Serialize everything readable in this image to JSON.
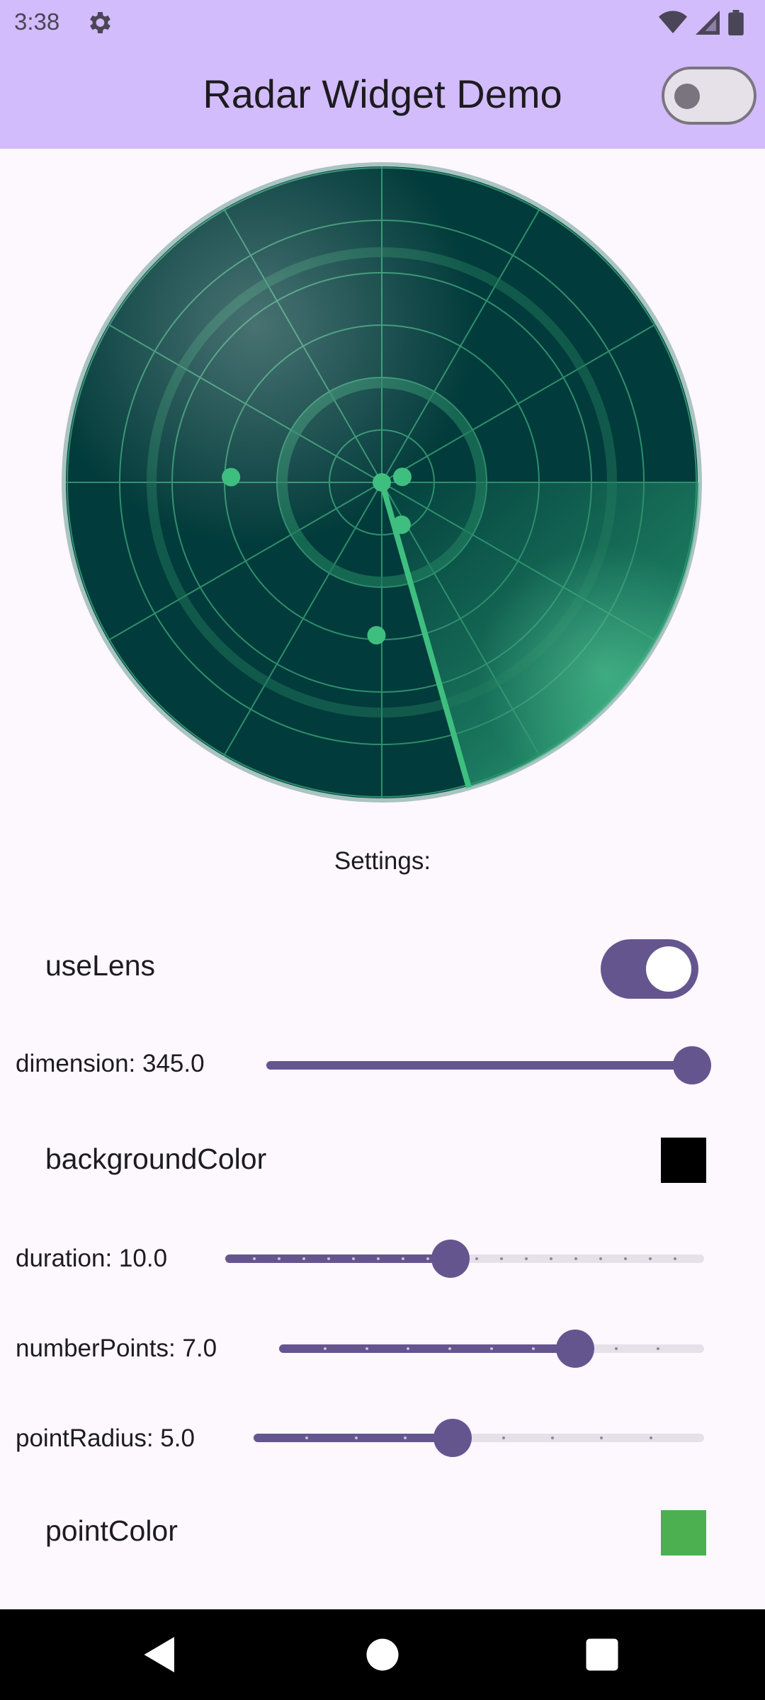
{
  "status_bar": {
    "time": "3:38",
    "icons": [
      "settings-icon",
      "wifi-icon",
      "cellular-icon",
      "battery-icon"
    ]
  },
  "app_bar": {
    "title": "Radar Widget Demo",
    "theme_toggle_on": false
  },
  "radar": {
    "use_lens": true,
    "sweep_angle_deg": 165,
    "colors": {
      "background": "#023b3b",
      "grid": "#2e8f6c",
      "point": "#3fbf7f",
      "border": "#a9c4c2"
    },
    "points": [
      {
        "name": "point-1",
        "angle_deg": 75,
        "distance": 0.1
      },
      {
        "name": "point-2",
        "angle_deg": 155,
        "distance": 0.22
      },
      {
        "name": "point-3",
        "angle_deg": 182,
        "distance": 0.72
      },
      {
        "name": "point-4",
        "angle_deg": 272,
        "distance": 0.71
      },
      {
        "name": "point-5",
        "angle_deg": 0,
        "distance": 0
      }
    ]
  },
  "settings": {
    "heading": "Settings:",
    "use_lens_label": "useLens",
    "dimension_label": "dimension: 345.0",
    "dimension_fraction": 1.0,
    "background_color_label": "backgroundColor",
    "background_color_value": "#000000",
    "duration_label": "duration: 10.0",
    "duration_fraction": 0.47,
    "duration_divisions": 19,
    "number_points_label": "numberPoints: 7.0",
    "number_points_fraction": 0.7,
    "number_points_divisions": 10,
    "point_radius_label": "pointRadius: 5.0",
    "point_radius_fraction": 0.44,
    "point_radius_divisions": 9,
    "point_color_label": "pointColor",
    "point_color_value": "#4caf50"
  },
  "nav_bar": {
    "icons": [
      "back-icon",
      "home-icon",
      "recents-icon"
    ]
  },
  "accent": "#65558f",
  "appbar_color": "#d2bcfb"
}
